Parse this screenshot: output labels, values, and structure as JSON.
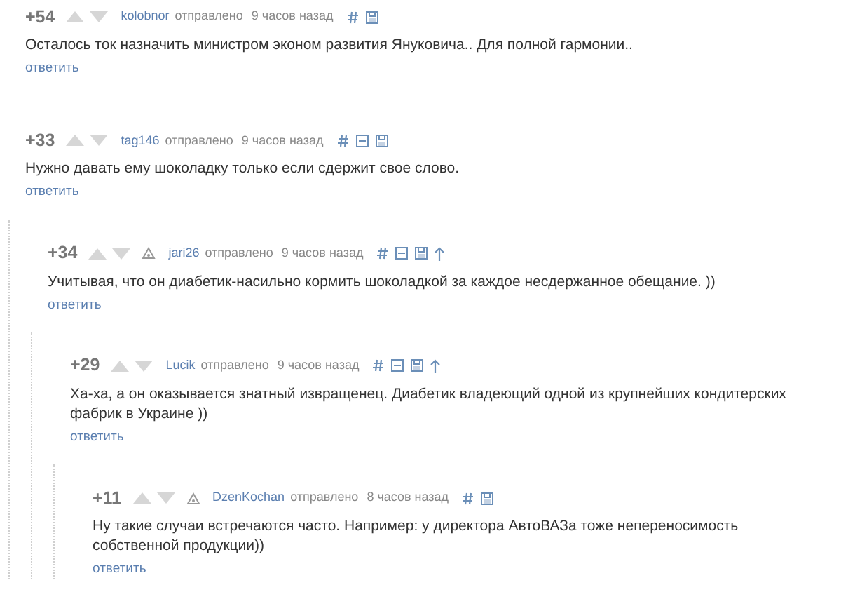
{
  "comments": [
    {
      "rating": "+54",
      "author": "kolobnor",
      "badge": false,
      "sent": "отправлено",
      "time": "9 часов назад",
      "tools": [
        {
          "kind": "hash"
        },
        {
          "kind": "save"
        }
      ],
      "text": "Осталось ток назначить министром эконом развития Януковича.. Для полной гармонии..",
      "reply": "ответить"
    },
    {
      "rating": "+33",
      "author": "tag146",
      "badge": false,
      "sent": "отправлено",
      "time": "9 часов назад",
      "tools": [
        {
          "kind": "hash"
        },
        {
          "kind": "collapse"
        },
        {
          "kind": "save"
        }
      ],
      "text": "Нужно давать ему шоколадку только если сдержит свое слово.",
      "reply": "ответить",
      "children": [
        {
          "rating": "+34",
          "author": "jari26",
          "badge": true,
          "sent": "отправлено",
          "time": "9 часов назад",
          "tools": [
            {
              "kind": "hash"
            },
            {
              "kind": "collapse"
            },
            {
              "kind": "save"
            },
            {
              "kind": "parent"
            }
          ],
          "text": "Учитывая, что он диабетик-насильно кормить шоколадкой за каждое несдержанное обещание. ))",
          "reply": "ответить",
          "children": [
            {
              "rating": "+29",
              "author": "Lucik",
              "badge": false,
              "sent": "отправлено",
              "time": "9 часов назад",
              "tools": [
                {
                  "kind": "hash"
                },
                {
                  "kind": "collapse"
                },
                {
                  "kind": "save"
                },
                {
                  "kind": "parent"
                }
              ],
              "text": "Ха-ха, а он оказывается знатный извращенец. Диабетик владеющий одной из крупнейших кондитерских фабрик в Украине ))",
              "reply": "ответить",
              "children": [
                {
                  "rating": "+11",
                  "author": "DzenKochan",
                  "badge": true,
                  "sent": "отправлено",
                  "time": "8 часов назад",
                  "tools": [
                    {
                      "kind": "hash"
                    },
                    {
                      "kind": "save"
                    }
                  ],
                  "text": "Ну такие случаи встречаются часто. Например: у директора АвтоВАЗа тоже непереносимость собственной продукции))",
                  "reply": "ответить"
                }
              ]
            }
          ]
        }
      ]
    }
  ]
}
